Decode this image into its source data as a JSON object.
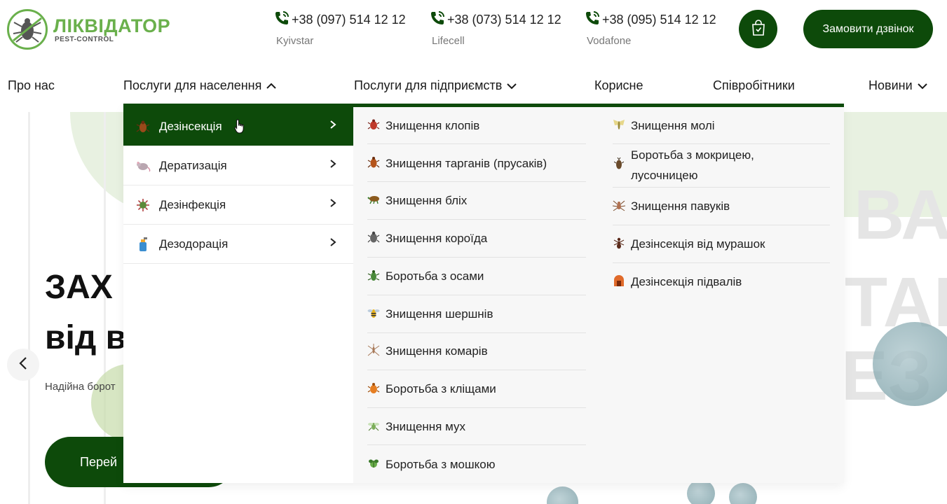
{
  "header": {
    "logo_title": "ЛІКВІДАТОР",
    "logo_sub": "PEST-CONTROL",
    "phones": [
      {
        "number": "+38 (097) 514 12 12",
        "operator": "Kyivstar"
      },
      {
        "number": "+38 (073) 514 12 12",
        "operator": "Lifecell"
      },
      {
        "number": "+38 (095) 514 12 12",
        "operator": "Vodafone"
      }
    ],
    "call_button": "Замовити дзвінок",
    "accent": "#0d4a0a",
    "logo_color": "#6ab04c"
  },
  "nav": {
    "items": [
      {
        "label": "Про нас"
      },
      {
        "label": "Послуги для населення"
      },
      {
        "label": "Послуги для підприємств"
      },
      {
        "label": "Корисне"
      },
      {
        "label": "Співробітники"
      },
      {
        "label": "Новини"
      }
    ]
  },
  "dropdown": {
    "categories": [
      {
        "label": "Дезінсекція",
        "icon": "cockroach-icon"
      },
      {
        "label": "Дератизація",
        "icon": "rat-icon"
      },
      {
        "label": "Дезінфекція",
        "icon": "virus-icon"
      },
      {
        "label": "Дезодорація",
        "icon": "spray-icon"
      }
    ],
    "column1": [
      {
        "label": "Знищення клопів",
        "icon": "bedbug-icon"
      },
      {
        "label": "Знищення тарганів (прусаків)",
        "icon": "cockroach-icon"
      },
      {
        "label": "Знищення бліх",
        "icon": "flea-icon"
      },
      {
        "label": "Знищення короїда",
        "icon": "bark-beetle-icon"
      },
      {
        "label": "Боротьба з осами",
        "icon": "wasp-icon"
      },
      {
        "label": "Знищення шершнів",
        "icon": "hornet-icon"
      },
      {
        "label": "Знищення комарів",
        "icon": "mosquito-icon"
      },
      {
        "label": "Боротьба з кліщами",
        "icon": "tick-icon"
      },
      {
        "label": "Знищення мух",
        "icon": "fly-icon"
      },
      {
        "label": "Боротьба з мошкою",
        "icon": "midge-icon"
      }
    ],
    "column2": [
      {
        "label": "Знищення молі",
        "icon": "moth-icon"
      },
      {
        "label": "Боротьба з мокрицею,",
        "label2": "лусочницею",
        "icon": "woodlouse-icon"
      },
      {
        "label": "Знищення павуків",
        "icon": "spider-icon"
      },
      {
        "label": "Дезінсекція від мурашок",
        "icon": "ant-icon"
      },
      {
        "label": "Дезінсекція підвалів",
        "icon": "basement-icon"
      }
    ]
  },
  "hero": {
    "title_line1": "ЗАХ",
    "title_line2": "від в",
    "desc": "Надійна борот",
    "button": "Перей",
    "bg_text1": "ВА",
    "bg_text2": "ТАЦ",
    "bg_text3": "ЕЗ"
  }
}
